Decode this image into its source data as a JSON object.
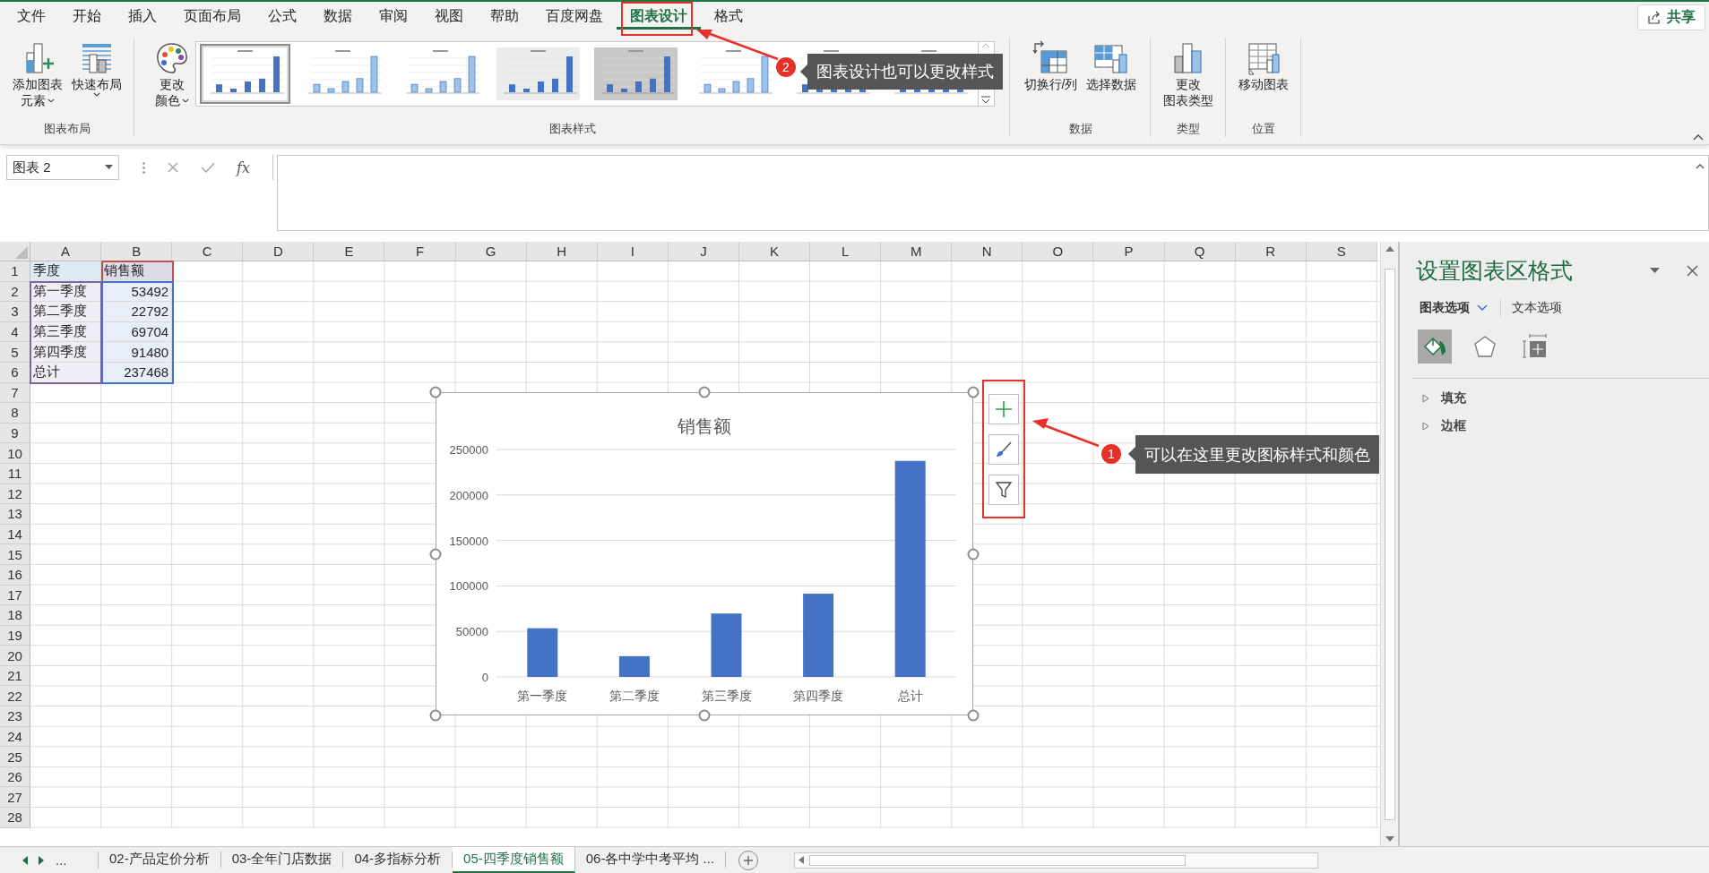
{
  "ribbon": {
    "tabs": [
      {
        "label": "文件",
        "selected": false
      },
      {
        "label": "开始",
        "selected": false
      },
      {
        "label": "插入",
        "selected": false
      },
      {
        "label": "页面布局",
        "selected": false
      },
      {
        "label": "公式",
        "selected": false
      },
      {
        "label": "数据",
        "selected": false
      },
      {
        "label": "审阅",
        "selected": false
      },
      {
        "label": "视图",
        "selected": false
      },
      {
        "label": "帮助",
        "selected": false
      },
      {
        "label": "百度网盘",
        "selected": false
      },
      {
        "label": "图表设计",
        "selected": true
      },
      {
        "label": "格式",
        "selected": false
      }
    ],
    "share_button": "共享",
    "groups": [
      {
        "label": "图表布局",
        "buttons": [
          {
            "kind": "add_element",
            "lines": [
              "添加图表",
              "元素"
            ],
            "dropdown": true
          },
          {
            "kind": "quick_layout",
            "lines": [
              "快速布局"
            ],
            "dropdown": true
          }
        ]
      },
      {
        "label": "图表样式",
        "buttons": [
          {
            "kind": "colors",
            "lines": [
              "更改",
              "颜色"
            ],
            "dropdown": true
          }
        ],
        "gallery": [
          {
            "selected": true
          },
          {
            "selected": false
          },
          {
            "selected": false
          },
          {
            "selected": false
          },
          {
            "selected": false
          },
          {
            "selected": false
          },
          {
            "selected": false
          },
          {
            "selected": false
          }
        ]
      },
      {
        "label": "数据",
        "buttons": [
          {
            "kind": "switch",
            "lines": [
              "切换行/列"
            ],
            "dropdown": false
          },
          {
            "kind": "select_data",
            "lines": [
              "选择数据"
            ],
            "dropdown": false
          }
        ]
      },
      {
        "label": "类型",
        "buttons": [
          {
            "kind": "chart_type",
            "lines": [
              "更改",
              "图表类型"
            ],
            "dropdown": false
          }
        ]
      },
      {
        "label": "位置",
        "buttons": [
          {
            "kind": "move",
            "lines": [
              "移动图表"
            ],
            "dropdown": false
          }
        ]
      }
    ]
  },
  "formula_bar": {
    "name_box": "图表 2",
    "function_label": "fx"
  },
  "sheet": {
    "columns": [
      "A",
      "B",
      "C",
      "D",
      "E",
      "F",
      "G",
      "H",
      "I",
      "J",
      "K",
      "L",
      "M",
      "N",
      "O",
      "P",
      "Q",
      "R",
      "S"
    ],
    "rows": [
      {
        "number": "1",
        "kind": "header",
        "cells": [
          "季度",
          "销售额"
        ]
      },
      {
        "number": "2",
        "kind": "data",
        "cells": [
          "第一季度",
          "53492"
        ]
      },
      {
        "number": "3",
        "kind": "data",
        "cells": [
          "第二季度",
          "22792"
        ]
      },
      {
        "number": "4",
        "kind": "data",
        "cells": [
          "第三季度",
          "69704"
        ]
      },
      {
        "number": "5",
        "kind": "data",
        "cells": [
          "第四季度",
          "91480"
        ]
      },
      {
        "number": "6",
        "kind": "data",
        "cells": [
          "总计",
          "237468"
        ]
      },
      {
        "number": "7"
      },
      {
        "number": "8"
      },
      {
        "number": "9"
      },
      {
        "number": "10"
      },
      {
        "number": "11"
      },
      {
        "number": "12"
      },
      {
        "number": "13"
      },
      {
        "number": "14"
      },
      {
        "number": "15"
      },
      {
        "number": "16"
      },
      {
        "number": "17"
      },
      {
        "number": "18"
      },
      {
        "number": "19"
      },
      {
        "number": "20"
      },
      {
        "number": "21"
      },
      {
        "number": "22"
      },
      {
        "number": "23"
      },
      {
        "number": "24"
      },
      {
        "number": "25"
      },
      {
        "number": "26"
      },
      {
        "number": "27"
      },
      {
        "number": "28"
      }
    ]
  },
  "chart": {
    "chart_data": {
      "type": "bar",
      "title": "销售额",
      "categories": [
        "第一季度",
        "第二季度",
        "第三季度",
        "第四季度",
        "总计"
      ],
      "series": [
        {
          "color": "#4472c4",
          "values": [
            53492,
            22792,
            69704,
            91480,
            237468
          ]
        }
      ],
      "grid": true,
      "ylim": [
        0,
        250000
      ],
      "yticks": [
        0,
        50000,
        100000,
        150000,
        200000,
        250000
      ]
    }
  },
  "format_pane": {
    "title": "设置图表区格式",
    "tabs": [
      {
        "label": "图表选项",
        "selected": true
      },
      {
        "label": "文本选项",
        "selected": false
      }
    ],
    "icon_tabs": [
      {
        "kind": "fill",
        "selected": true
      },
      {
        "kind": "effects",
        "selected": false
      },
      {
        "kind": "size",
        "selected": false
      }
    ],
    "sections": [
      {
        "label": "填充",
        "expanded": false
      },
      {
        "label": "边框",
        "expanded": false
      }
    ]
  },
  "sheet_tabs": {
    "overflow": "...",
    "tabs": [
      {
        "label": "02-产品定价分析",
        "selected": false
      },
      {
        "label": "03-全年门店数据",
        "selected": false
      },
      {
        "label": "04-多指标分析",
        "selected": false
      },
      {
        "label": "05-四季度销售额",
        "selected": true
      },
      {
        "label": "06-各中学中考平均 ...",
        "selected": false
      }
    ]
  },
  "annotations": [
    {
      "number": "2",
      "text": "图表设计也可以更改样式"
    },
    {
      "number": "1",
      "text": "可以在这里更改图标样式和颜色"
    }
  ]
}
